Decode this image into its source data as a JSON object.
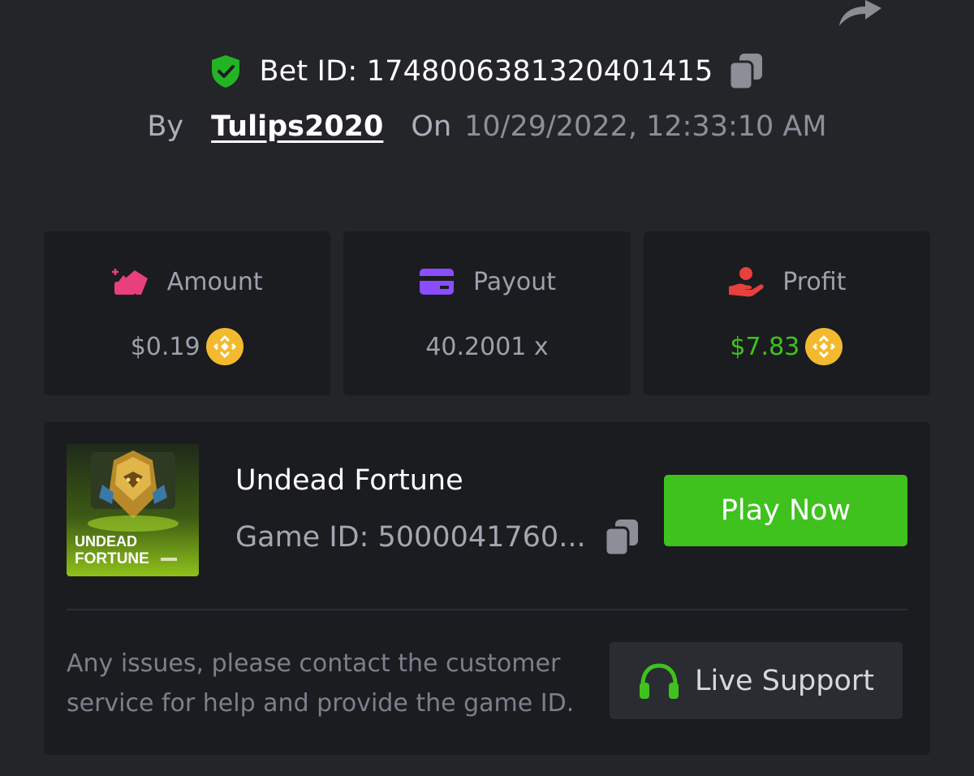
{
  "header": {
    "bet_id_label": "Bet ID: 1748006381320401415",
    "by_label": "By",
    "username": "Tulips2020",
    "on_label": "On",
    "date": "10/29/2022, 12:33:10 AM",
    "icons": [
      "share-icon",
      "shield-check-icon",
      "copy-icon"
    ]
  },
  "stats": [
    {
      "label": "Amount",
      "value": "$0.19",
      "icon": "coins-icon",
      "icon_color": "#e8407a",
      "currency_icon": "bnb-coin-icon"
    },
    {
      "label": "Payout",
      "value": "40.2001 x",
      "icon": "credit-card-icon",
      "icon_color": "#8a4dff"
    },
    {
      "label": "Profit",
      "value": "$7.83",
      "icon": "hand-user-icon",
      "icon_color": "#e8403c",
      "value_color": "#3fc21e",
      "currency_icon": "bnb-coin-icon"
    }
  ],
  "game": {
    "name": "Undead Fortune",
    "id_label": "Game ID: 5000041760...",
    "thumb_title_line1": "UNDEAD",
    "thumb_title_line2": "FORTUNE",
    "play_label": "Play Now"
  },
  "support": {
    "help_text": "Any issues, please contact the customer service for help and provide the game ID.",
    "button_label": "Live Support",
    "icon": "headset-icon"
  },
  "colors": {
    "background": "#242529",
    "card": "#1b1c20",
    "accent_green": "#3fc21e",
    "coin_gold": "#f3ba2f"
  }
}
